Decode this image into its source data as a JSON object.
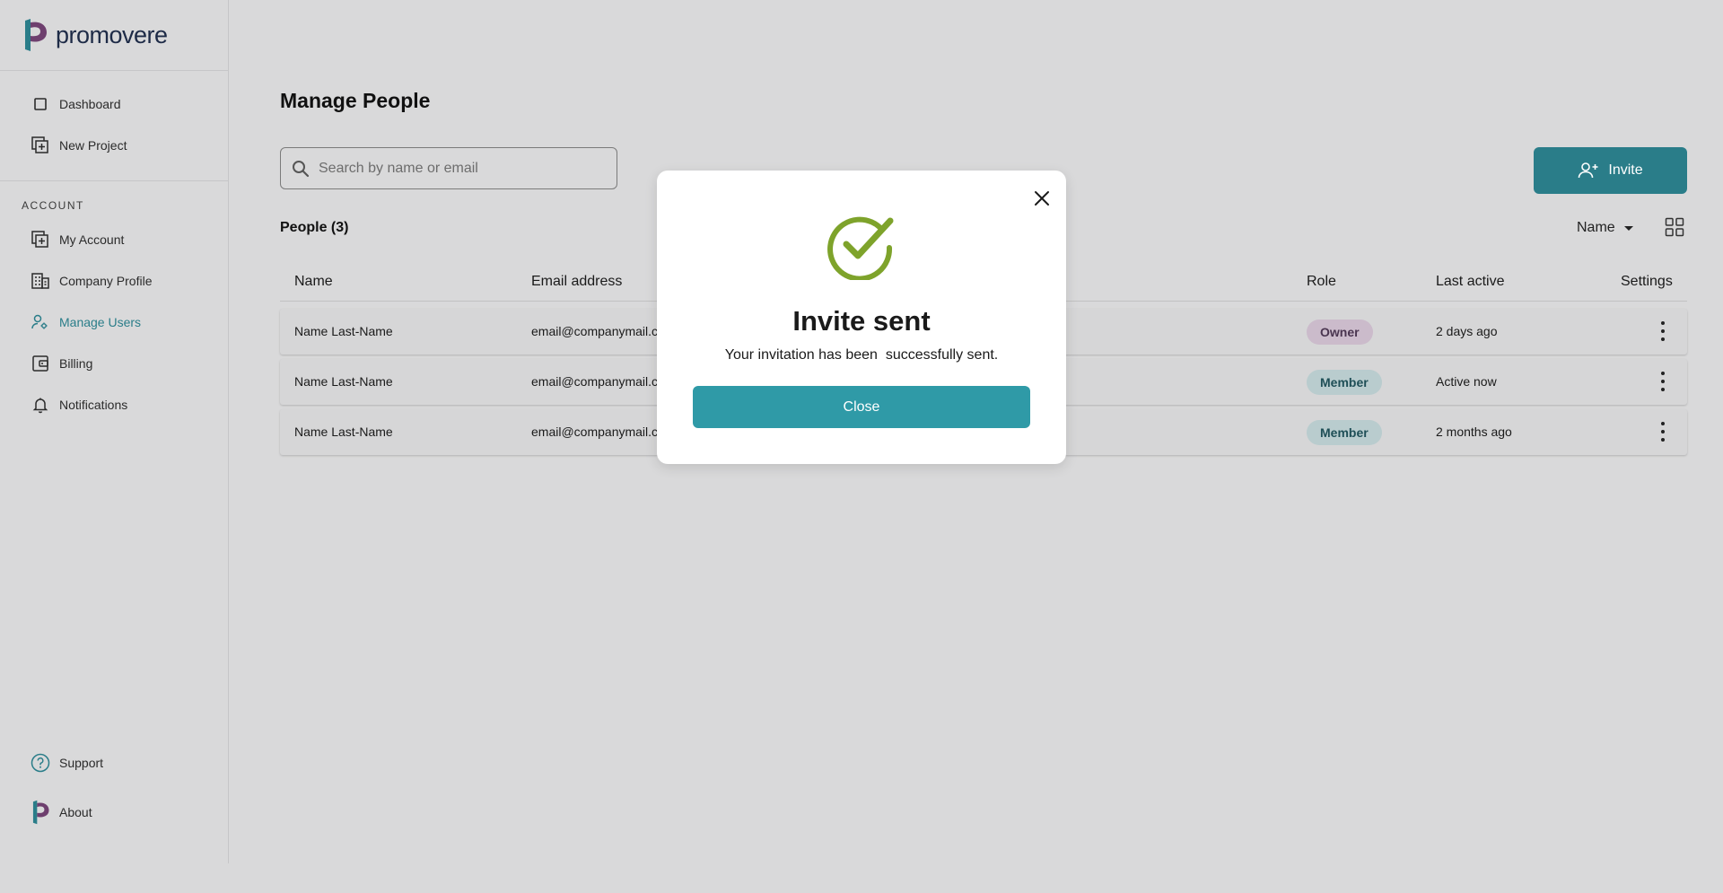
{
  "brand": {
    "name": "promovere",
    "color": "#2a7d89"
  },
  "sidebar": {
    "top_items": [
      {
        "label": "Dashboard",
        "icon": "square-icon"
      },
      {
        "label": "New Project",
        "icon": "add-project-icon"
      }
    ],
    "section_label": "ACCOUNT",
    "account_items": [
      {
        "label": "My Account",
        "icon": "add-project-icon"
      },
      {
        "label": "Company Profile",
        "icon": "building-icon"
      },
      {
        "label": "Manage Users",
        "icon": "users-icon",
        "active": true
      },
      {
        "label": "Billing",
        "icon": "wallet-icon"
      },
      {
        "label": "Notifications",
        "icon": "bell-icon"
      }
    ],
    "bottom_items": [
      {
        "label": "Support",
        "icon": "help-circle-icon"
      },
      {
        "label": "About",
        "icon": "logo-icon"
      }
    ]
  },
  "main": {
    "title": "Manage People",
    "search": {
      "placeholder": "Search by name or email"
    },
    "invite_label": "Invite",
    "people_count": "People (3)",
    "sort_label": "Name",
    "columns": [
      "Name",
      "Email address",
      "Role",
      "Last active",
      "Settings"
    ],
    "rows": [
      {
        "name": "Name Last-Name",
        "email": "email@companymail.c",
        "role": "Owner",
        "last_active": "2 days ago"
      },
      {
        "name": "Name Last-Name",
        "email": "email@companymail.c",
        "role": "Member",
        "last_active": "Active now"
      },
      {
        "name": "Name Last-Name",
        "email": "email@companymail.c",
        "role": "Member",
        "last_active": "2 months ago"
      }
    ]
  },
  "modal": {
    "title": "Invite sent",
    "message": "Your invitation has been  successfully sent.",
    "button_label": "Close",
    "check_color": "#7ea32b"
  }
}
